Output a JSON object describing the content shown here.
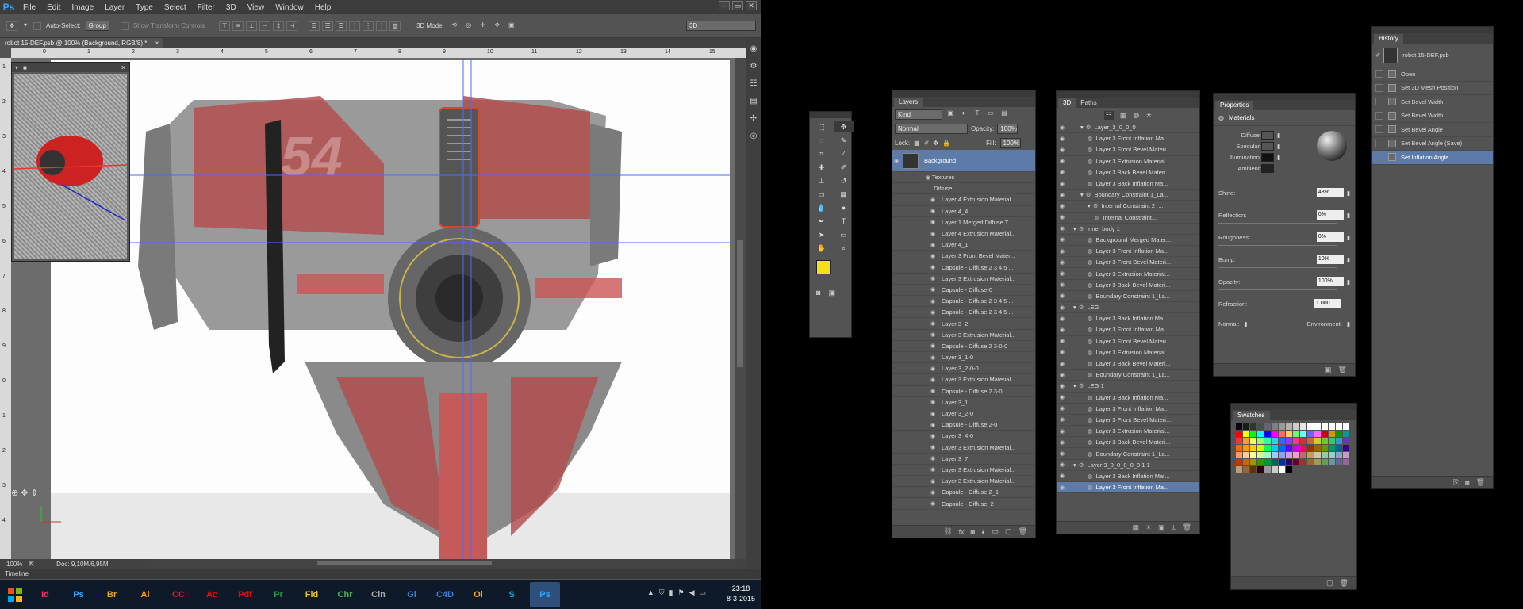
{
  "menubar": {
    "logo": "Ps",
    "items": [
      "File",
      "Edit",
      "Image",
      "Layer",
      "Type",
      "Select",
      "Filter",
      "3D",
      "View",
      "Window",
      "Help"
    ],
    "window_buttons": [
      "–",
      "▭",
      "✕"
    ]
  },
  "options_bar": {
    "auto_select_label": "Auto-Select:",
    "auto_select_value": "Group",
    "transform_controls_label": "Show Transform Controls",
    "mode_3d_label": "3D Mode:",
    "workspace": "3D"
  },
  "document": {
    "tab_title": "robot 15-DEF.psb @ 100% (Background, RGB/8) *",
    "zoom": "100%",
    "doc_size": "Doc: 9,10M/6,95M",
    "ruler_top": [
      "0",
      "1",
      "2",
      "3",
      "4",
      "5",
      "6",
      "7",
      "8",
      "9",
      "10",
      "11",
      "12",
      "13",
      "14",
      "15"
    ],
    "ruler_left": [
      "1",
      "2",
      "3",
      "4",
      "5",
      "6",
      "7",
      "8",
      "9",
      "0",
      "1",
      "2",
      "3",
      "4"
    ]
  },
  "timeline": "Timeline",
  "taskbar": {
    "apps": [
      {
        "name": "Id",
        "color": "#ff3366"
      },
      {
        "name": "Ps",
        "color": "#31a8ff"
      },
      {
        "name": "Br",
        "color": "#e8a33d"
      },
      {
        "name": "Ai",
        "color": "#ff9a00"
      },
      {
        "name": "CC",
        "color": "#da1f26"
      },
      {
        "name": "Ac",
        "color": "#ff0000"
      },
      {
        "name": "Pdf",
        "color": "#ff0000"
      },
      {
        "name": "Pr",
        "color": "#2b9348"
      },
      {
        "name": "Fld",
        "color": "#f0c040"
      },
      {
        "name": "Chr",
        "color": "#4caf50"
      },
      {
        "name": "Cin",
        "color": "#aaaaaa"
      },
      {
        "name": "Gl",
        "color": "#3b7fd4"
      },
      {
        "name": "C4D",
        "color": "#3b7fd4"
      },
      {
        "name": "Ol",
        "color": "#f5a623"
      },
      {
        "name": "S",
        "color": "#00aff0"
      },
      {
        "name": "Ps",
        "color": "#31a8ff"
      }
    ],
    "time": "23:18",
    "date": "8-3-2015"
  },
  "layers_panel": {
    "tab": "Layers",
    "filter": "Kind",
    "blend_mode": "Normal",
    "opacity_label": "Opacity:",
    "opacity": "100%",
    "lock_label": "Lock:",
    "fill_label": "Fill:",
    "fill": "100%",
    "background_layer": "Background",
    "textures_label": "Textures",
    "diffuse_label": "Diffuse",
    "items": [
      "Layer 4 Extrusion Material...",
      "Layer 4_4",
      "Layer 1 Merged Diffuse T...",
      "Layer 4 Extrusion Material...",
      "Layer 4_1",
      "Layer 3 Front Bevel Mater...",
      "Capsule - Diffuse 2 3 4 5 ...",
      "Layer 3 Extrusion Material...",
      "Capsule - Diffuse-0",
      "Capsule - Diffuse 2 3 4 5 ...",
      "Capsule - Diffuse 2 3 4 5 ...",
      "Layer 3_2",
      "Layer 3 Extrusion Material...",
      "Capsule - Diffuse 2 3-0-0",
      "Layer 3_1-0",
      "Layer 3_2-0-0",
      "Layer 3 Extrusion Material...",
      "Capsule - Diffuse 2 3-0",
      "Layer 3_1",
      "Layer 3_2-0",
      "Capsule - Diffuse 2-0",
      "Layer 3_4-0",
      "Layer 3 Extrusion Material...",
      "Layer 3_7",
      "Layer 3 Extrusion Material...",
      "Layer 3 Extrusion Material...",
      "Capsule - Diffuse 2_1",
      "Capsule - Diffuse_2"
    ]
  },
  "panel_3d": {
    "tabs": [
      "3D",
      "Paths"
    ],
    "items": [
      {
        "label": "Layer_3_0_0_0",
        "indent": 2,
        "group": true
      },
      {
        "label": "Layer 3 Front Inflation Ma...",
        "indent": 3
      },
      {
        "label": "Layer 3 Front Bevel Materi...",
        "indent": 3
      },
      {
        "label": "Layer 3 Extrusion Material...",
        "indent": 3
      },
      {
        "label": "Layer 3 Back Bevel Materi...",
        "indent": 3
      },
      {
        "label": "Layer 3 Back Inflation Ma...",
        "indent": 3
      },
      {
        "label": "Boundary Constraint 1_La...",
        "indent": 2,
        "group": true
      },
      {
        "label": "Internal Constraint 2_...",
        "indent": 3,
        "group": true
      },
      {
        "label": "Internal Constraint...",
        "indent": 4
      },
      {
        "label": "inner body 1",
        "indent": 1,
        "group": true
      },
      {
        "label": "Background Merged Mater...",
        "indent": 3
      },
      {
        "label": "Layer 3 Front Inflation Ma...",
        "indent": 3
      },
      {
        "label": "Layer 3 Front Bevel Materi...",
        "indent": 3
      },
      {
        "label": "Layer 3 Extrusion Material...",
        "indent": 3
      },
      {
        "label": "Layer 3 Back Bevel Materi...",
        "indent": 3
      },
      {
        "label": "Boundary Constraint 1_La...",
        "indent": 3
      },
      {
        "label": "LEG",
        "indent": 1,
        "group": true
      },
      {
        "label": "Layer 3 Back Inflation Ma...",
        "indent": 3
      },
      {
        "label": "Layer 3 Front Inflation Ma...",
        "indent": 3
      },
      {
        "label": "Layer 3 Front Bevel Materi...",
        "indent": 3
      },
      {
        "label": "Layer 3 Extrusion Material...",
        "indent": 3
      },
      {
        "label": "Layer 3 Back Bevel Materi...",
        "indent": 3
      },
      {
        "label": "Boundary Constraint 1_La...",
        "indent": 3
      },
      {
        "label": "LEG 1",
        "indent": 1,
        "group": true
      },
      {
        "label": "Layer 3 Back Inflation Ma...",
        "indent": 3
      },
      {
        "label": "Layer 3 Front Inflation Ma...",
        "indent": 3
      },
      {
        "label": "Layer 3 Front Bevel Materi...",
        "indent": 3
      },
      {
        "label": "Layer 3 Extrusion Material...",
        "indent": 3
      },
      {
        "label": "Layer 3 Back Bevel Materi...",
        "indent": 3
      },
      {
        "label": "Boundary Constraint 1_La...",
        "indent": 3
      },
      {
        "label": "Layer 3_0_0_0_0_0 1 1",
        "indent": 1,
        "group": true
      },
      {
        "label": "Layer 3 Back Inflation Mat...",
        "indent": 3
      },
      {
        "label": "Layer 3 Front Inflation Ma...",
        "indent": 3,
        "selected": true
      }
    ]
  },
  "properties_panel": {
    "tab": "Properties",
    "section": "Materials",
    "diffuse_label": "Diffuse:",
    "specular_label": "Specular:",
    "illumination_label": "Illumination:",
    "ambient_label": "Ambient:",
    "shine_label": "Shine:",
    "shine": "48%",
    "reflection_label": "Reflection:",
    "reflection": "0%",
    "roughness_label": "Roughness:",
    "roughness": "0%",
    "bump_label": "Bump:",
    "bump": "10%",
    "opacity_label": "Opacity:",
    "opacity": "100%",
    "refraction_label": "Refraction:",
    "refraction": "1.000",
    "normal_label": "Normal:",
    "environment_label": "Environment:"
  },
  "swatches_panel": {
    "tab": "Swatches",
    "colors": [
      "#000000",
      "#1a1a1a",
      "#333333",
      "#4d4d4d",
      "#666666",
      "#808080",
      "#999999",
      "#b3b3b3",
      "#cccccc",
      "#e6e6e6",
      "#ffffff",
      "#ffffff",
      "#ffffff",
      "#ffffff",
      "#ffffff",
      "#ffffff",
      "#ff0000",
      "#ffff00",
      "#00ff00",
      "#00ffff",
      "#0000ff",
      "#ff00ff",
      "#ff6666",
      "#ffcc66",
      "#66ff66",
      "#66ffff",
      "#6666ff",
      "#ff66ff",
      "#cc0000",
      "#cc9900",
      "#009900",
      "#009999",
      "#ff3333",
      "#ff9933",
      "#ffff66",
      "#99ff66",
      "#33ff99",
      "#33ccff",
      "#3366ff",
      "#9933ff",
      "#ff3399",
      "#cc3333",
      "#cc6633",
      "#cccc33",
      "#66cc33",
      "#33cc66",
      "#3399cc",
      "#6633cc",
      "#ff6600",
      "#ff9900",
      "#ffcc00",
      "#ccff00",
      "#00ff66",
      "#00ccff",
      "#0066ff",
      "#6600ff",
      "#cc00ff",
      "#ff0066",
      "#993300",
      "#996600",
      "#669900",
      "#009966",
      "#006699",
      "#330099",
      "#ff9966",
      "#ffcc99",
      "#ffff99",
      "#ccff99",
      "#99ffcc",
      "#99ccff",
      "#9999ff",
      "#cc99ff",
      "#ff99cc",
      "#cc6666",
      "#cc9966",
      "#cccc99",
      "#99cc99",
      "#99cccc",
      "#9999cc",
      "#cc99cc",
      "#cc3300",
      "#cc6600",
      "#999900",
      "#339900",
      "#009933",
      "#006666",
      "#003399",
      "#330066",
      "#660033",
      "#993333",
      "#996633",
      "#999966",
      "#669966",
      "#669999",
      "#666699",
      "#996699",
      "#cc9966",
      "#996633",
      "#663300",
      "#330000",
      "#999999",
      "#cccccc",
      "#ffffff",
      "#000000"
    ]
  },
  "history_panel": {
    "tab": "History",
    "snapshot": "robot 15-DEF.psb",
    "items": [
      "Open",
      "Set 3D Mesh Position",
      "Set Bevel Width",
      "Set Bevel Width",
      "Set Bevel Angle",
      "Set Bevel Angle (Save)",
      "Set Inflation Angle"
    ],
    "selected_index": 6
  }
}
